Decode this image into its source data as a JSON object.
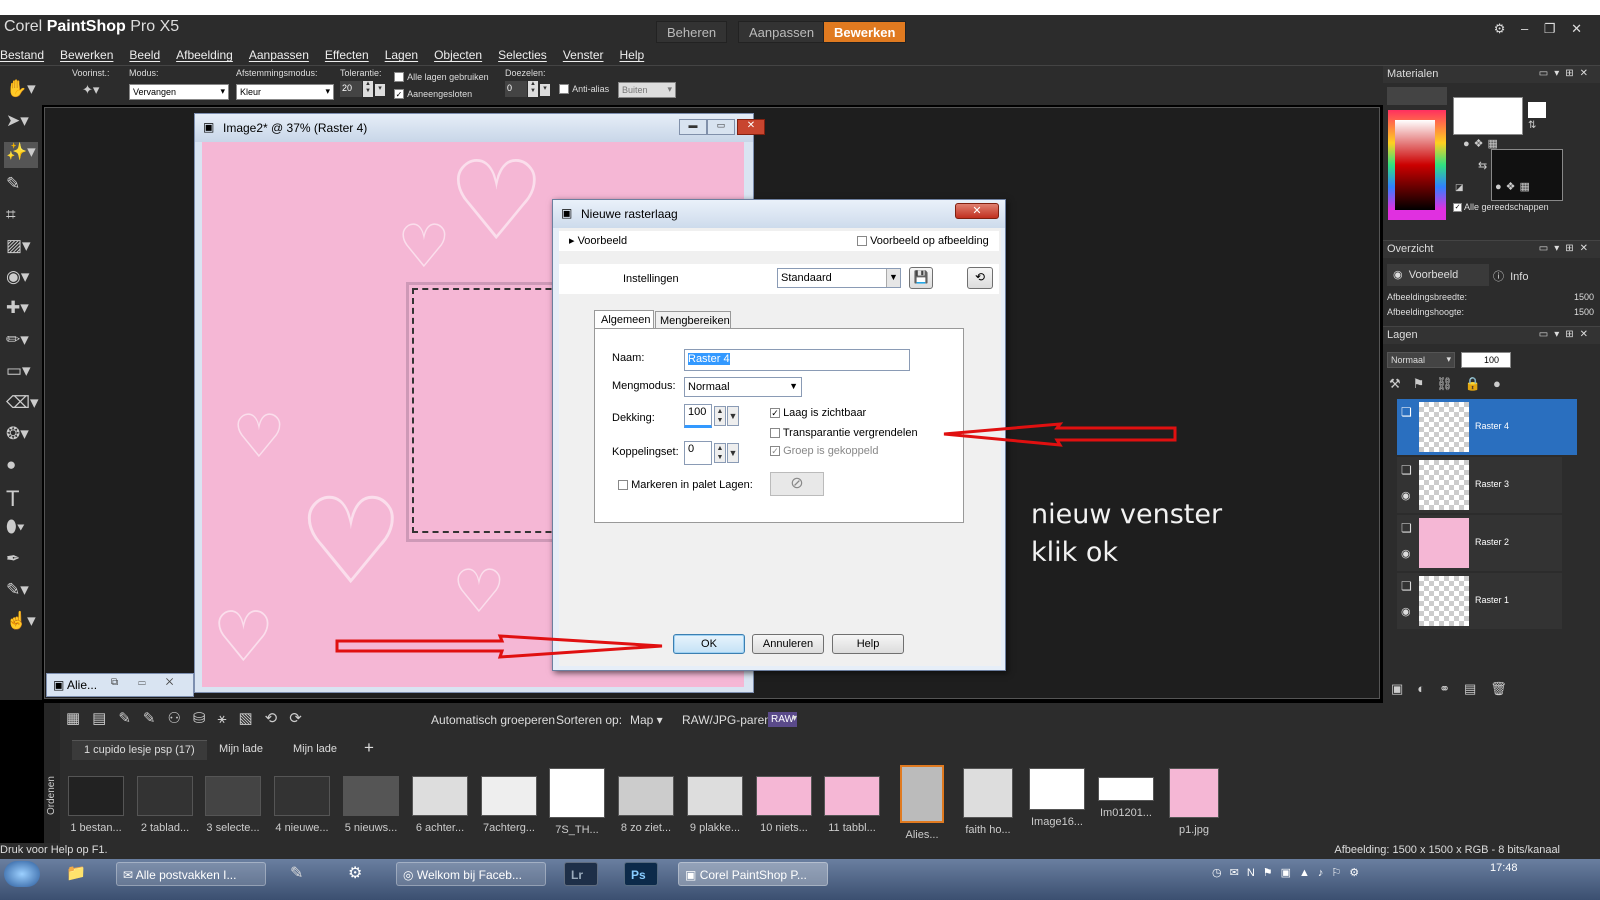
{
  "window": {
    "title_prefix": "Corel ",
    "title_bold": "PaintShop",
    "title_suffix": " Pro X5",
    "tabs": [
      "Beheren",
      "Aanpassen",
      "Bewerken"
    ],
    "active_tab": "Bewerken",
    "controls": "⚙ – ❐ ✕"
  },
  "menu": [
    "Bestand",
    "Bewerken",
    "Beeld",
    "Afbeelding",
    "Aanpassen",
    "Effecten",
    "Lagen",
    "Objecten",
    "Selecties",
    "Venster",
    "Help"
  ],
  "tool_options": {
    "presets_label": "Voorinst.:",
    "mode_label": "Modus:",
    "mode_value": "Vervangen",
    "match_label": "Afstemmingsmodus:",
    "match_value": "Kleur",
    "tolerance_label": "Tolerantie:",
    "tolerance_value": "20",
    "all_layers_label": "Alle lagen gebruiken",
    "contiguous_label": "Aaneengesloten",
    "feather_label": "Doezelen:",
    "feather_value": "0",
    "antialias_label": "Anti-alias",
    "outside_value": "Buiten"
  },
  "image_window": {
    "title": "Image2* @  37% (Raster 4)",
    "minimized_label": "Alie..."
  },
  "dialog": {
    "title": "Nieuwe rasterlaag",
    "close": "✕",
    "preview_label": "Voorbeeld",
    "preview_on_image_label": "Voorbeeld op afbeelding",
    "settings_label": "Instellingen",
    "settings_value": "Standaard",
    "tabs": [
      "Algemeen",
      "Mengbereiken"
    ],
    "name_label": "Naam:",
    "name_value": "Raster 4",
    "blend_label": "Mengmodus:",
    "blend_value": "Normaal",
    "opacity_label": "Dekking:",
    "opacity_value": "100",
    "linkset_label": "Koppelingset:",
    "linkset_value": "0",
    "visible_label": "Laag is zichtbaar",
    "lock_transparency_label": "Transparantie vergrendelen",
    "group_linked_label": "Groep is gekoppeld",
    "highlight_label": "Markeren in palet Lagen:",
    "ok": "OK",
    "cancel": "Annuleren",
    "help": "Help"
  },
  "annotation": {
    "line1": "nieuw venster",
    "line2": "klik ok"
  },
  "materials": {
    "title": "Materialen",
    "all_tools_label": "Alle gereedschappen"
  },
  "overview": {
    "title": "Overzicht",
    "tab_preview": "Voorbeeld",
    "tab_info": "Info",
    "width_label": "Afbeeldingsbreedte:",
    "width_value": "1500",
    "height_label": "Afbeeldingshoogte:",
    "height_value": "1500"
  },
  "layers": {
    "title": "Lagen",
    "blend_value": "Normaal",
    "opacity_value": "100",
    "items": [
      "Raster 4",
      "Raster 3",
      "Raster 2",
      "Raster 1"
    ]
  },
  "organizer": {
    "side_label": "Ordenen",
    "auto_group": "Automatisch groeperen",
    "sort_label": "Sorteren op:",
    "sort_value": "Map",
    "raw_label": "RAW/JPG-paren:",
    "raw_badge": "RAW",
    "tabs": [
      "1 cupido lesje psp (17)",
      "Mijn lade",
      "Mijn lade"
    ],
    "add_tab": "+",
    "thumbs": [
      "1 bestan...",
      "2 tablad...",
      "3 selecte...",
      "4 nieuwe...",
      "5 nieuws...",
      "6 achter...",
      "7achterg...",
      "7S_TH...",
      "8 zo ziet...",
      "9 plakke...",
      "10 niets...",
      "11 tabbl...",
      "Alies...",
      "faith ho...",
      "Image16...",
      "Im01201...",
      "p1.jpg"
    ]
  },
  "status": {
    "left": "Druk voor Help op F1.",
    "right": "Afbeelding:  1500 x 1500 x RGB - 8 bits/kanaal"
  },
  "taskbar": {
    "items": [
      "Alle postvakken I...",
      "Welkom bij Faceb...",
      "Lr",
      "Ps",
      "Corel PaintShop P..."
    ],
    "clock": "17:48"
  },
  "colors": {
    "accent": "#e07a20",
    "canvas_pink": "#f5b7d5",
    "selected_layer": "#2a6fbf",
    "arrow_red": "#e01010"
  }
}
